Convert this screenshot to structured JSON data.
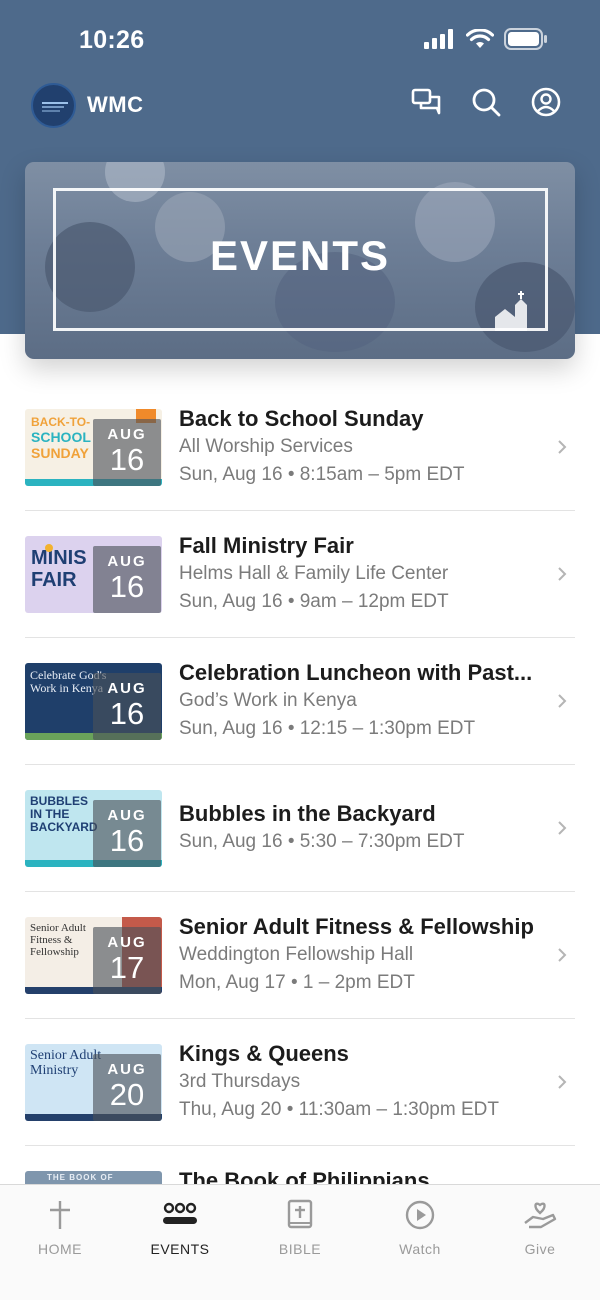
{
  "status_bar": {
    "time": "10:26"
  },
  "header": {
    "brand": "WMC",
    "logo_icon": "church-logo-icon",
    "actions": [
      "chat-icon",
      "search-icon",
      "profile-icon"
    ]
  },
  "hero": {
    "title": "EVENTS"
  },
  "events": [
    {
      "title": "Back to School Sunday",
      "location": "All Worship Services",
      "time": "Sun, Aug 16 • 8:15am – 5pm EDT",
      "month": "AUG",
      "day": "16",
      "thumb": {
        "lines": [
          "BACK-TO-",
          "SCHOOL",
          "SUNDAY"
        ]
      }
    },
    {
      "title": "Fall Ministry Fair",
      "location": "Helms Hall & Family Life Center",
      "time": "Sun, Aug 16 • 9am – 12pm EDT",
      "month": "AUG",
      "day": "16",
      "thumb": {
        "lines": [
          "MINIS",
          "FAIR"
        ]
      }
    },
    {
      "title": "Celebration Luncheon with Past...",
      "location": "God’s Work in Kenya",
      "time": "Sun, Aug 16 • 12:15 – 1:30pm EDT",
      "month": "AUG",
      "day": "16",
      "thumb": {
        "lines": [
          "Celebrate God's",
          "Work in Kenya"
        ]
      }
    },
    {
      "title": "Bubbles in the Backyard",
      "location": "",
      "time": "Sun, Aug 16 • 5:30 – 7:30pm EDT",
      "month": "AUG",
      "day": "16",
      "thumb": {
        "lines": [
          "BUBBLES",
          "IN THE",
          "BACKYARD"
        ]
      }
    },
    {
      "title": "Senior Adult Fitness & Fellowship",
      "location": "Weddington Fellowship Hall",
      "time": "Mon, Aug 17 • 1 – 2pm EDT",
      "month": "AUG",
      "day": "17",
      "thumb": {
        "lines": [
          "Senior Adult",
          "Fitness &",
          "Fellowship"
        ]
      }
    },
    {
      "title": "Kings & Queens",
      "location": "3rd Thursdays",
      "time": "Thu, Aug 20 • 11:30am – 1:30pm EDT",
      "month": "AUG",
      "day": "20",
      "thumb": {
        "lines": [
          "Senior Adult",
          "Ministry"
        ]
      }
    },
    {
      "title": "The Book of Philippians",
      "location": "",
      "time": "",
      "month": "",
      "day": "",
      "thumb": {
        "lines": [
          "THE BOOK OF"
        ]
      }
    }
  ],
  "tabs": [
    {
      "label": "HOME",
      "icon": "cross-icon",
      "active": false
    },
    {
      "label": "EVENTS",
      "icon": "people-group-icon",
      "active": true
    },
    {
      "label": "BIBLE",
      "icon": "bible-icon",
      "active": false
    },
    {
      "label": "Watch",
      "icon": "play-circle-icon",
      "active": false
    },
    {
      "label": "Give",
      "icon": "heart-hand-icon",
      "active": false
    }
  ],
  "colors": {
    "header_bg": "#4e6a8b",
    "active_tab": "#222222",
    "inactive_tab": "#9a9a9a"
  }
}
